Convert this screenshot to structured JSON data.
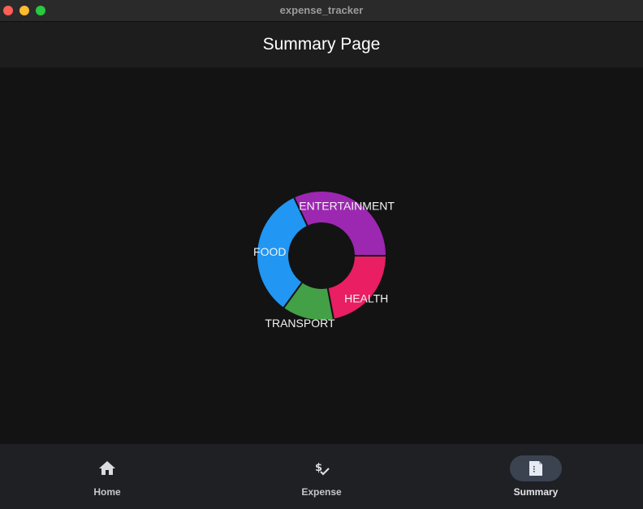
{
  "window": {
    "title": "expense_tracker"
  },
  "appbar": {
    "title": "Summary Page"
  },
  "chart_data": {
    "type": "pie",
    "title": "",
    "categories": [
      "HEALTH",
      "TRANSPORT",
      "FOOD",
      "ENTERTAINMENT"
    ],
    "values": [
      22,
      13,
      33,
      32
    ],
    "colors": [
      "#e91e63",
      "#43a047",
      "#2196f3",
      "#9c27b0"
    ],
    "donut": true
  },
  "nav": {
    "items": [
      {
        "label": "Home",
        "icon": "home-icon",
        "active": false
      },
      {
        "label": "Expense",
        "icon": "dollar-check-icon",
        "active": false
      },
      {
        "label": "Summary",
        "icon": "summary-document-icon",
        "active": true
      }
    ]
  }
}
